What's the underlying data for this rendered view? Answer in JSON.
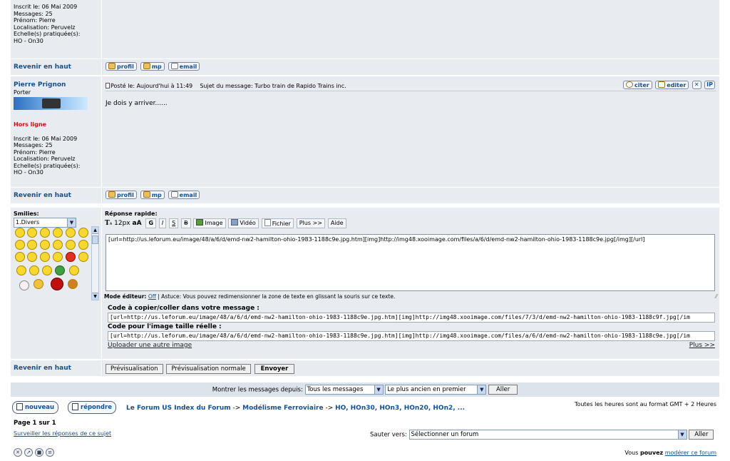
{
  "post1": {
    "profile_lines": [
      "Inscrit le: 06 Mai 2009",
      "Messages: 25",
      "Prénom: Pierre",
      "Localisation: Peruvelz",
      "Echelle(s) pratiquée(s):",
      "HO - On30"
    ],
    "back_label": "Revenir en haut",
    "buttons": {
      "profil": "profil",
      "mp": "mp",
      "email": "email"
    }
  },
  "post2": {
    "author": "Pierre Prignon",
    "rank": "Porter",
    "status": "Hors ligne",
    "profile_lines": [
      "Inscrit le: 06 Mai 2009",
      "Messages: 25",
      "Prénom: Pierre",
      "Localisation: Peruvelz",
      "Echelle(s) pratiquée(s):",
      "HO - On30"
    ],
    "header": "Posté le: Aujourd'hui à 11:49    Sujet du message: Turbo train de Rapido Trains inc.",
    "actions": {
      "citer": "citer",
      "editer": "editer"
    },
    "body": "Je dois y arriver......",
    "back_label": "Revenir en haut",
    "buttons": {
      "profil": "profil",
      "mp": "mp",
      "email": "email"
    }
  },
  "reply": {
    "smilies_label": "Smilies:",
    "smilies_select": "1.Divers",
    "title": "Réponse rapide:",
    "toolbar": {
      "size": "12px",
      "bold": "G",
      "italic": "I",
      "underline": "S",
      "strike": "B",
      "image": "Image",
      "video": "Vidéo",
      "file": "Fichier",
      "more": "Plus >>",
      "help": "Aide"
    },
    "text": "[url=http://us.leforum.eu/image/48/a/6/d/emd-nw2-hamilton-ohio-1983-1188c9e.jpg.htm][img]http://img48.xooimage.com/files/a/6/d/emd-nw2-hamilton-ohio-1983-1188c9e.jpg[/img][/url]",
    "editor_mode_label": "Mode éditeur:",
    "editor_mode_value": "Off",
    "tip": " | Astuce: Vous pouvez redimensionner la zone de texte en glissant la souris sur ce texte.",
    "code_copy_label": "Code à copier/coller dans votre message :",
    "code_copy": "[url=http://us.leforum.eu/image/48/a/6/d/emd-nw2-hamilton-ohio-1983-1188c9e.jpg.htm][img]http://img48.xooimage.com/files/7/3/d/emd-nw2-hamilton-ohio-1983-1188c9f.jpg[/im",
    "code_full_label": "Code pour l'image taille réelle :",
    "code_full": "[url=http://us.leforum.eu/image/48/a/6/d/emd-nw2-hamilton-ohio-1983-1188c9e.jpg.htm][img]http://img48.xooimage.com/files/a/6/d/emd-nw2-hamilton-ohio-1983-1188c9e.jpg[/im",
    "upload_other": "Uploader une autre image",
    "more": "Plus >>",
    "back_label": "Revenir en haut",
    "preview": "Prévisualisation",
    "preview_normal": "Prévisualisation normale",
    "send": "Envoyer"
  },
  "filter": {
    "label": "Montrer les messages depuis:",
    "since": "Tous les messages",
    "order": "Le plus ancien en premier",
    "go": "Aller"
  },
  "footer": {
    "new_topic": "nouveau",
    "reply": "répondre",
    "breadcrumb_home": "Le Forum US Index du Forum",
    "breadcrumb_sep": " -> ",
    "breadcrumb_cat": "Modélisme Ferroviaire",
    "breadcrumb_forum": "HO, HOn30, HOn3, HOn20, HOn2, ...",
    "timezone": "Toutes les heures sont au format GMT + 2 Heures",
    "page": "Page 1 sur 1",
    "watch": "Surveiller les réponses de ce sujet",
    "jump_label": "Sauter vers:",
    "jump_select": "Sélectionner un forum",
    "jump_go": "Aller",
    "moderate_prefix": "Vous ",
    "moderate_bold": "pouvez",
    "moderate_link": "modérer ce forum"
  }
}
